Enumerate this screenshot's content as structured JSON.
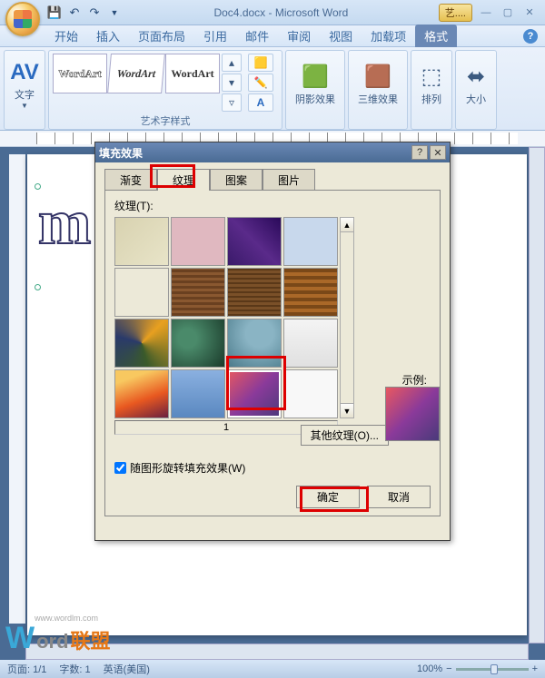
{
  "title": "Doc4.docx - Microsoft Word",
  "yt_button": "艺....",
  "qat": {
    "save_tip": "保存",
    "undo_tip": "撤销",
    "redo_tip": "重做"
  },
  "menu": {
    "tabs": [
      "开始",
      "插入",
      "页面布局",
      "引用",
      "邮件",
      "审阅",
      "视图",
      "加载项",
      "格式"
    ],
    "active_index": 8
  },
  "ribbon": {
    "group_text": "文字",
    "group_styles": "艺术字样式",
    "wordart_label": "WordArt",
    "shadow": "阴影效果",
    "threeD": "三维效果",
    "arrange": "排列",
    "size": "大小",
    "av_label": "AV"
  },
  "dialog": {
    "title": "填充效果",
    "tabs": [
      "渐变",
      "纹理",
      "图案",
      "图片"
    ],
    "active_tab": 1,
    "texture_label": "纹理(T):",
    "selected_name": "1",
    "other_textures": "其他纹理(O)...",
    "sample": "示例:",
    "rotate_checkbox": "随图形旋转填充效果(W)",
    "rotate_checked": true,
    "ok": "确定",
    "cancel": "取消",
    "selected_index": 14
  },
  "status": {
    "page": "页面: 1/1",
    "words": "字数: 1",
    "lang": "英语(美国)",
    "zoom": "100%"
  },
  "watermark": {
    "url": "www.wordlm.com",
    "text1": "W",
    "text2": "ord",
    "text3": "联盟"
  }
}
